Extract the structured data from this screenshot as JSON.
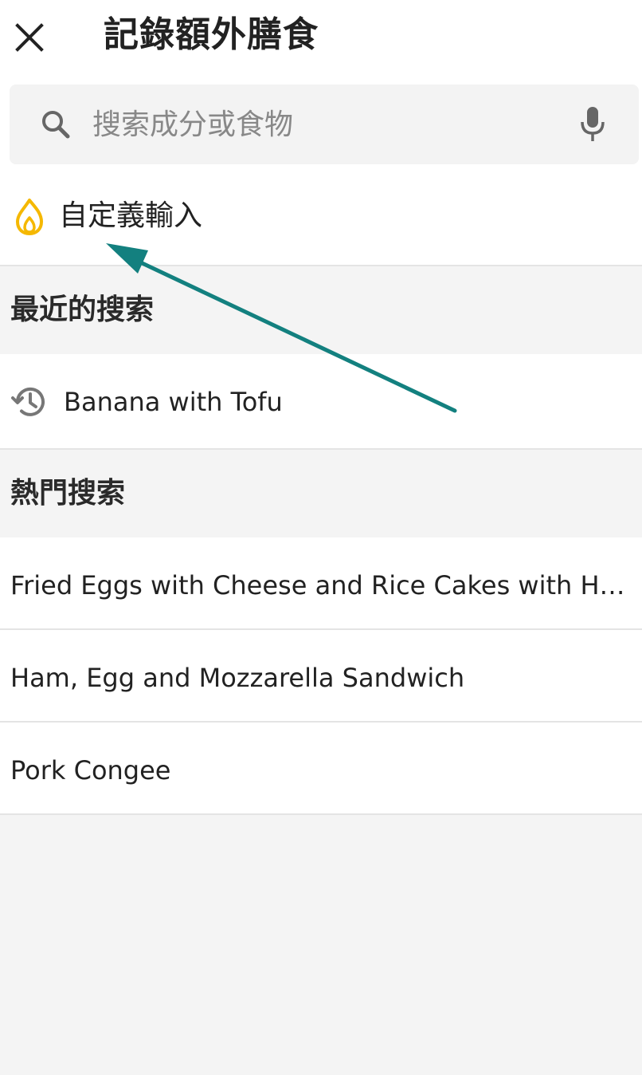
{
  "header": {
    "title": "記錄額外膳食",
    "close_icon": "close-icon"
  },
  "search": {
    "placeholder": "搜索成分或食物",
    "value": "",
    "search_icon": "search-icon",
    "mic_icon": "microphone-icon"
  },
  "custom_entry": {
    "label": "自定義輸入",
    "icon": "flame-icon",
    "icon_color": "#f5b800"
  },
  "recent": {
    "header": "最近的搜索",
    "items": [
      {
        "label": "Banana with Tofu",
        "icon": "history-icon"
      }
    ]
  },
  "popular": {
    "header": "熱門搜索",
    "items": [
      {
        "label": "Fried Eggs with Cheese and Rice Cakes with Hummus"
      },
      {
        "label": "Ham, Egg and Mozzarella Sandwich"
      },
      {
        "label": "Pork Congee"
      }
    ]
  },
  "annotation": {
    "arrow_color": "#13807f"
  }
}
